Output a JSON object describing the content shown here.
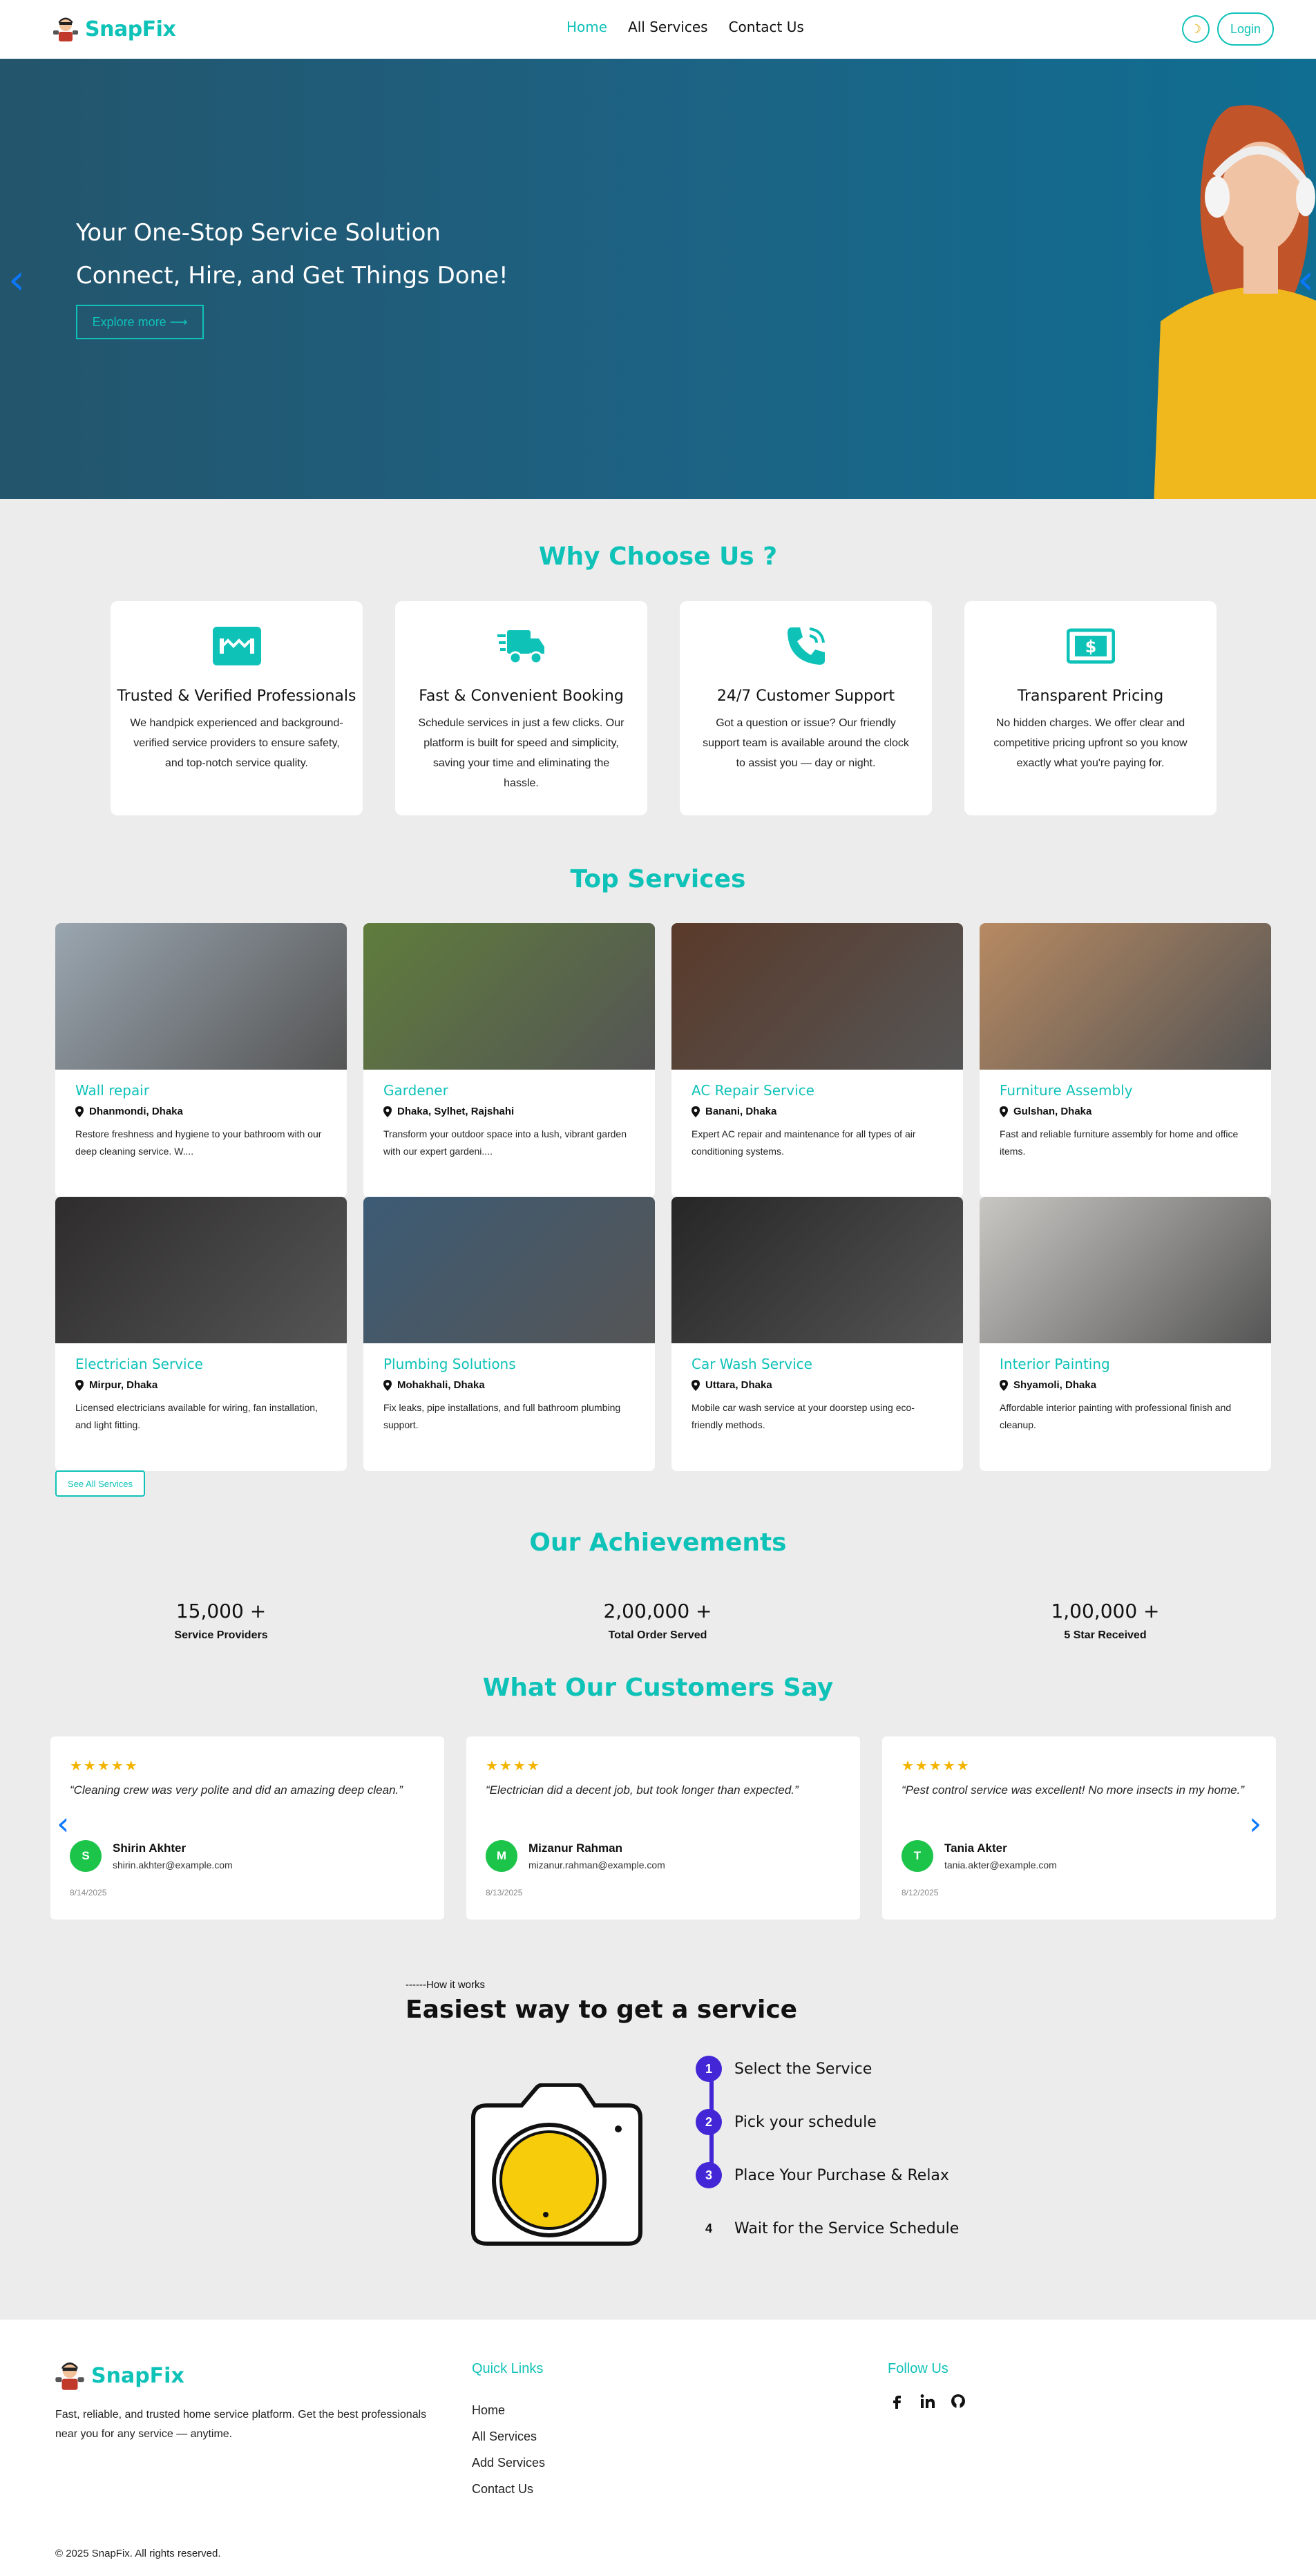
{
  "nav": {
    "brand": "SnapFix",
    "links": [
      "Home",
      "All Services",
      "Contact Us"
    ],
    "login": "Login"
  },
  "hero": {
    "line1": "Your One-Stop Service Solution",
    "line2": "Connect, Hire, and Get Things Done!",
    "cta": "Explore more ⟶"
  },
  "why": {
    "title": "Why Choose Us ?",
    "cards": [
      {
        "icon": "handshake-icon",
        "title": "Trusted & Verified Professionals",
        "text": "We handpick experienced and background-verified service providers to ensure safety, and top-notch service quality."
      },
      {
        "icon": "truck-icon",
        "title": "Fast & Convenient Booking",
        "text": "Schedule services in just a few clicks. Our platform is built for speed and simplicity, saving your time and eliminating the hassle."
      },
      {
        "icon": "phone-icon",
        "title": "24/7 Customer Support",
        "text": "Got a question or issue? Our friendly support team is available around the clock to assist you — day or night."
      },
      {
        "icon": "money-icon",
        "title": "Transparent Pricing",
        "text": "No hidden charges. We offer clear and competitive pricing upfront so you know exactly what you're paying for."
      }
    ]
  },
  "services": {
    "title": "Top Services",
    "items": [
      {
        "name": "Wall repair",
        "location": "Dhanmondi, Dhaka",
        "desc": "Restore freshness and hygiene to your bathroom with our deep cleaning service. W....",
        "color": "#9aa6b0"
      },
      {
        "name": "Gardener",
        "location": "Dhaka, Sylhet, Rajshahi",
        "desc": "Transform your outdoor space into a lush, vibrant garden with our expert gardeni....",
        "color": "#5f7d3c"
      },
      {
        "name": "AC Repair Service",
        "location": "Banani, Dhaka",
        "desc": "Expert AC repair and maintenance for all types of air conditioning systems.",
        "color": "#5a3a2a"
      },
      {
        "name": "Furniture Assembly",
        "location": "Gulshan, Dhaka",
        "desc": "Fast and reliable furniture assembly for home and office items.",
        "color": "#b78a62"
      },
      {
        "name": "Electrician Service",
        "location": "Mirpur, Dhaka",
        "desc": "Licensed electricians available for wiring, fan installation, and light fitting.",
        "color": "#2e2c2c"
      },
      {
        "name": "Plumbing Solutions",
        "location": "Mohakhali, Dhaka",
        "desc": "Fix leaks, pipe installations, and full bathroom plumbing support.",
        "color": "#3c5b75"
      },
      {
        "name": "Car Wash Service",
        "location": "Uttara, Dhaka",
        "desc": "Mobile car wash service at your doorstep using eco-friendly methods.",
        "color": "#262626"
      },
      {
        "name": "Interior Painting",
        "location": "Shyamoli, Dhaka",
        "desc": "Affordable interior painting with professional finish and cleanup.",
        "color": "#c9c7c3"
      }
    ],
    "see_all": "See All Services"
  },
  "achievements": {
    "title": "Our Achievements",
    "items": [
      {
        "value": "15,000 +",
        "label": "Service Providers"
      },
      {
        "value": "2,00,000 +",
        "label": "Total Order Served"
      },
      {
        "value": "1,00,000 +",
        "label": "5 Star Received"
      }
    ]
  },
  "reviews": {
    "title": "What Our Customers Say",
    "items": [
      {
        "stars": "★★★★★",
        "quote": "“Cleaning crew was very polite and did an amazing deep clean.”",
        "initial": "S",
        "name": "Shirin Akhter",
        "email": "shirin.akhter@example.com",
        "date": "8/14/2025"
      },
      {
        "stars": "★★★★",
        "quote": "“Electrician did a decent job, but took longer than expected.”",
        "initial": "M",
        "name": "Mizanur Rahman",
        "email": "mizanur.rahman@example.com",
        "date": "8/13/2025"
      },
      {
        "stars": "★★★★★",
        "quote": "“Pest control service was excellent! No more insects in my home.”",
        "initial": "T",
        "name": "Tania Akter",
        "email": "tania.akter@example.com",
        "date": "8/12/2025"
      }
    ]
  },
  "how": {
    "kicker": "------How it works",
    "title": "Easiest way to get a service",
    "steps": [
      "Select the Service",
      "Pick your schedule",
      "Place Your Purchase & Relax",
      "Wait for the Service Schedule"
    ]
  },
  "footer": {
    "brand": "SnapFix",
    "desc": "Fast, reliable, and trusted home service platform. Get the best professionals near you for any service — anytime.",
    "quick_title": "Quick Links",
    "quick_links": [
      "Home",
      "All Services",
      "Add Services",
      "Contact Us"
    ],
    "follow_title": "Follow Us",
    "copyright": "© 2025 SnapFix. All rights reserved."
  },
  "colors": {
    "accent": "#0fc2b8",
    "step": "#4327d6",
    "arrow": "#0c78ff",
    "star": "#f3b400"
  }
}
